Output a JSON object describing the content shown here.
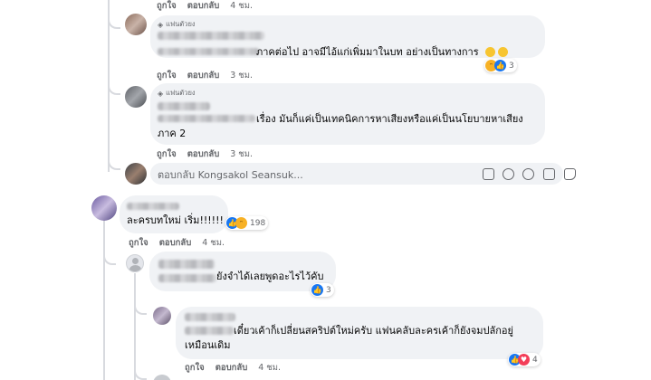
{
  "colors": {
    "bubble": "#f0f2f5",
    "secondary_text": "#65676b",
    "like_blue": "#1877f2",
    "haha_yellow": "#f7b125"
  },
  "top_actions": {
    "like": "ถูกใจ",
    "reply": "ตอบกลับ",
    "time": "4 ชม."
  },
  "reply1": {
    "badge": "แฟนตัวยง",
    "text": "ภาคต่อไป อาจมีไอ้แก่เพิ่มมาในบท อย่างเป็นทางการ",
    "reaction_count": "3",
    "like": "ถูกใจ",
    "reply": "ตอบกลับ",
    "time": "3 ชม."
  },
  "reply2": {
    "badge": "แฟนตัวยง",
    "line1": "เรื่อง มันก็แค่เป็นเทคนิคการหาเสียงหรือแค่เป็นนโยบายหาเสียง",
    "line2": "ภาค 2",
    "like": "ถูกใจ",
    "reply": "ตอบกลับ",
    "time": "3 ชม."
  },
  "reply_input": {
    "placeholder": "ตอบกลับ Kongsakol Seansuk...",
    "tools": [
      "sticker-icon",
      "emoji-icon",
      "camera-icon",
      "gif-icon",
      "smiley-sticker-icon"
    ]
  },
  "comment2": {
    "text": "ละครบทใหม่ เริ่ม!!!!!!",
    "reaction_count": "198",
    "like": "ถูกใจ",
    "reply": "ตอบกลับ",
    "time": "4 ชม."
  },
  "reply3": {
    "text": "ยังจำได้เลยพูดอะไรไว้คับ",
    "reaction_count": "3"
  },
  "reply4": {
    "line1": "เดี๋ยวเค้าก็เปลี่ยนสคริปต์ใหม่ครับ แฟนคลับละครเค้าก็ยังจมปลักอยู่",
    "line2": "เหมือนเดิม",
    "reaction_count": "4",
    "like": "ถูกใจ",
    "reply": "ตอบกลับ",
    "time": "4 ชม."
  }
}
